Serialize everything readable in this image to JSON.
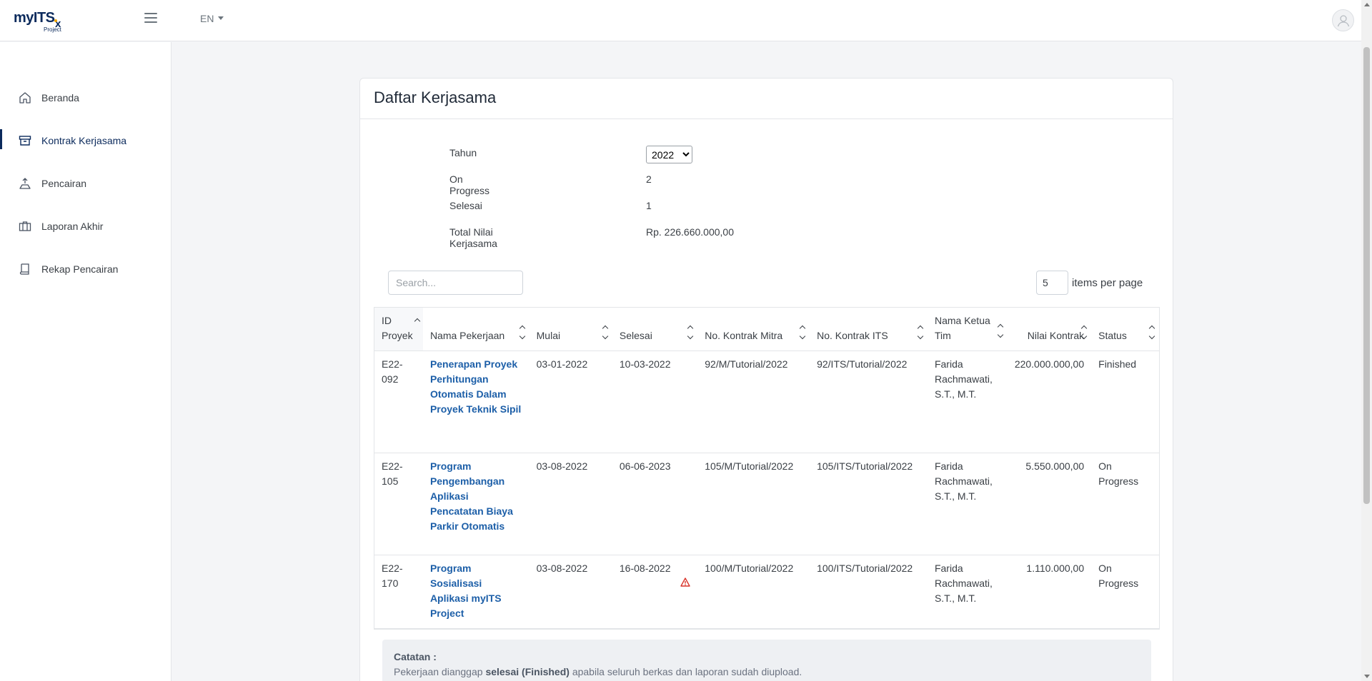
{
  "app": {
    "logo_text": "myITS",
    "logo_suffix": "x",
    "logo_sub": "Project",
    "language": "EN"
  },
  "sidebar": {
    "items": [
      {
        "label": "Beranda",
        "icon": "home-icon",
        "active": false
      },
      {
        "label": "Kontrak Kerjasama",
        "icon": "archive-icon",
        "active": true
      },
      {
        "label": "Pencairan",
        "icon": "disbursement-icon",
        "active": false
      },
      {
        "label": "Laporan Akhir",
        "icon": "briefcase-icon",
        "active": false
      },
      {
        "label": "Rekap Pencairan",
        "icon": "book-icon",
        "active": false
      }
    ]
  },
  "page": {
    "title": "Daftar Kerjasama"
  },
  "summary": {
    "year_label": "Tahun",
    "year_value": "2022",
    "year_options": [
      "2022"
    ],
    "on_progress_label": "On Progress",
    "on_progress_value": "2",
    "finished_label": "Selesai",
    "finished_value": "1",
    "total_label": "Total Nilai Kerjasama",
    "total_value": "Rp. 226.660.000,00"
  },
  "search": {
    "placeholder": "Search..."
  },
  "pagination": {
    "per_page_value": "5",
    "per_page_label": "items per page"
  },
  "table": {
    "headers": {
      "id": "ID Proyek",
      "name": "Nama Pekerjaan",
      "start": "Mulai",
      "end": "Selesai",
      "partner_contract": "No. Kontrak Mitra",
      "its_contract": "No. Kontrak ITS",
      "leader": "Nama Ketua Tim",
      "value": "Nilai Kontrak",
      "status": "Status"
    },
    "rows": [
      {
        "id": "E22-092",
        "name": "Penerapan Proyek Perhitungan Otomatis Dalam Proyek Teknik Sipil",
        "start": "03-01-2022",
        "end": "10-03-2022",
        "partner_contract": "92/M/Tutorial/2022",
        "its_contract": "92/ITS/Tutorial/2022",
        "leader": "Farida Rachmawati, S.T., M.T.",
        "value": "220.000.000,00",
        "status": "Finished",
        "warning": false
      },
      {
        "id": "E22-105",
        "name": "Program Pengembangan Aplikasi Pencatatan Biaya Parkir Otomatis",
        "start": "03-08-2022",
        "end": "06-06-2023",
        "partner_contract": "105/M/Tutorial/2022",
        "its_contract": "105/ITS/Tutorial/2022",
        "leader": "Farida Rachmawati, S.T., M.T.",
        "value": "5.550.000,00",
        "status": "On Progress",
        "warning": false
      },
      {
        "id": "E22-170",
        "name": "Program Sosialisasi Aplikasi myITS Project",
        "start": "03-08-2022",
        "end": "16-08-2022",
        "partner_contract": "100/M/Tutorial/2022",
        "its_contract": "100/ITS/Tutorial/2022",
        "leader": "Farida Rachmawati, S.T., M.T.",
        "value": "1.110.000,00",
        "status": "On Progress",
        "warning": true
      }
    ]
  },
  "note": {
    "title": "Catatan :",
    "text_before": "Pekerjaan dianggap",
    "text_bold": "selesai (Finished)",
    "text_after": "apabila seluruh berkas dan laporan sudah diupload."
  },
  "colors": {
    "brand": "#0b2a5c",
    "link": "#1d5fa8",
    "warning": "#d9342b"
  }
}
